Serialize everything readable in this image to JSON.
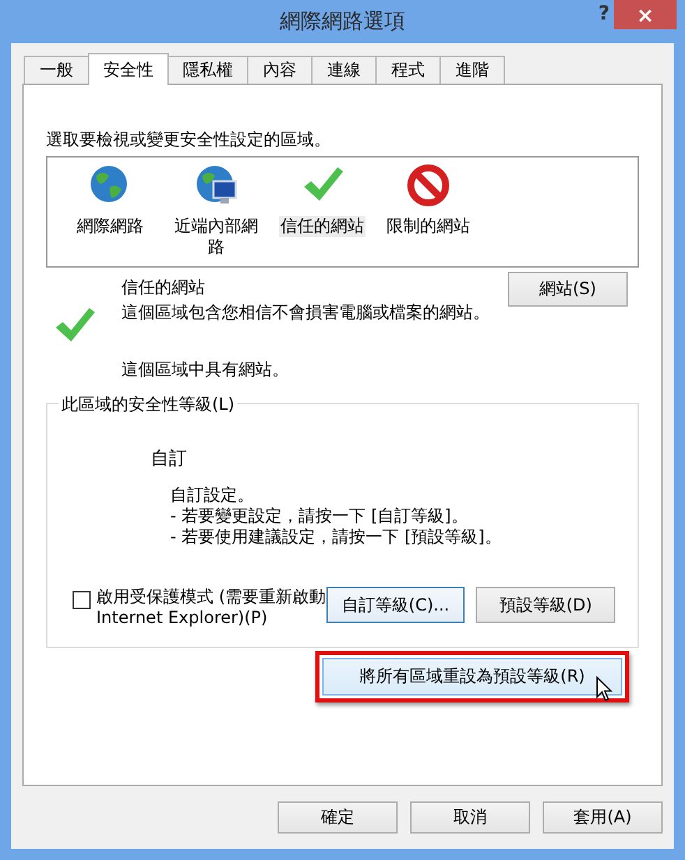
{
  "window": {
    "title": "網際網路選項",
    "help": "?",
    "close": "×"
  },
  "tabs": [
    {
      "label": "一般",
      "selected": false
    },
    {
      "label": "安全性",
      "selected": true
    },
    {
      "label": "隱私權",
      "selected": false
    },
    {
      "label": "內容",
      "selected": false
    },
    {
      "label": "連線",
      "selected": false
    },
    {
      "label": "程式",
      "selected": false
    },
    {
      "label": "進階",
      "selected": false
    }
  ],
  "zone_prompt": "選取要檢視或變更安全性設定的區域。",
  "zones": [
    {
      "kind": "internet",
      "label": "網際網路",
      "selected": false
    },
    {
      "kind": "intranet",
      "label": "近端內部網路",
      "selected": false
    },
    {
      "kind": "trusted",
      "label": "信任的網站",
      "selected": true
    },
    {
      "kind": "restricted",
      "label": "限制的網站",
      "selected": false
    }
  ],
  "zone_info": {
    "kind": "trusted",
    "title": "信任的網站",
    "description": "這個區域包含您相信不會損害電腦或檔案的網站。",
    "sites_button": "網站(S)",
    "status": "這個區域中具有網站。"
  },
  "security_level": {
    "legend": "此區域的安全性等級(L)",
    "level_name": "自訂",
    "details": [
      "自訂設定。",
      "- 若要變更設定，請按一下 [自訂等級]。",
      "- 若要使用建議設定，請按一下 [預設等級]。"
    ],
    "protected_mode": {
      "label": "啟用受保護模式 (需要重新啟動 Internet Explorer)(P)",
      "checked": false
    },
    "custom_button": {
      "label": "自訂等級(C)...",
      "focused": true
    },
    "default_button": {
      "label": "預設等級(D)",
      "focused": false
    }
  },
  "reset_button": {
    "label": "將所有區域重設為預設等級(R)",
    "highlighted": true
  },
  "buttons": [
    "確定",
    "取消",
    "套用(A)"
  ]
}
